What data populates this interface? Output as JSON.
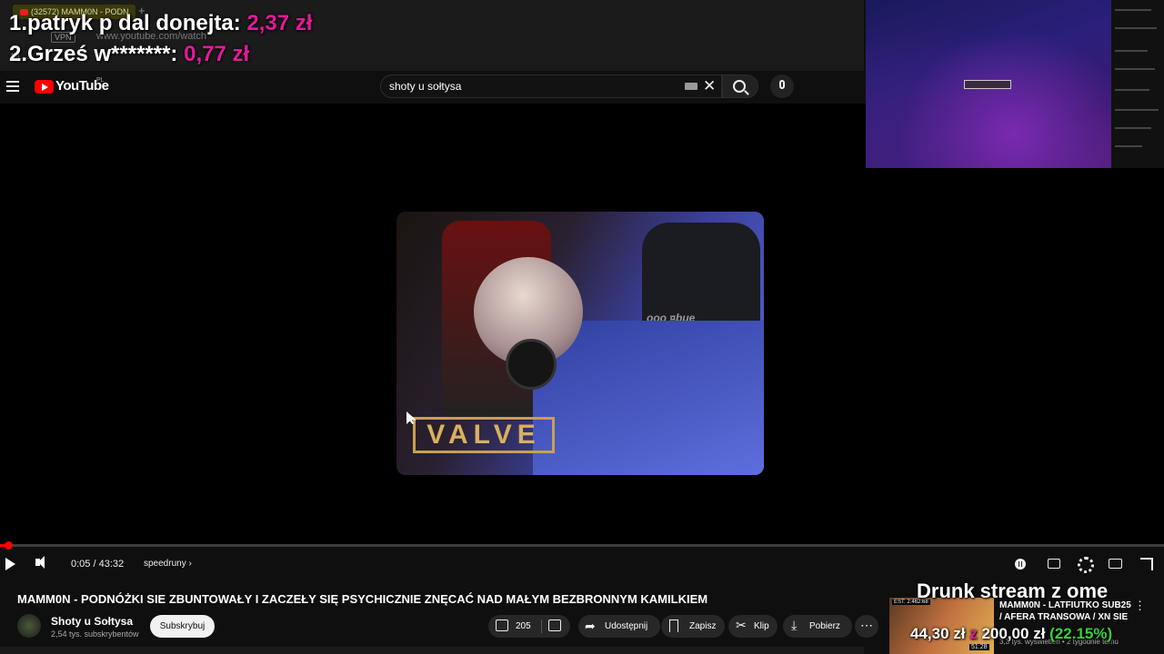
{
  "browser": {
    "tab_title": "(32572) MAMM0N - PODN",
    "new_tab": "+",
    "vpn_label": "VPN",
    "url": "www.youtube.com/watch",
    "bookmarks": "ML..."
  },
  "donations": [
    {
      "rank_name": "1.patryk p dal donejta:",
      "amount": "2,37 zł"
    },
    {
      "rank_name": "2.Grześ w*******:",
      "amount": "0,77 zł"
    }
  ],
  "header": {
    "logo_text": "YouTube",
    "logo_country": "PL",
    "search_value": "shoty u sołtysa"
  },
  "player": {
    "progress": 0.002,
    "time": "0:05 / 43:32",
    "chapter": "speedruny ›",
    "overlay_text": "VALVE",
    "chair_text": "ooo ¤bue"
  },
  "video": {
    "title": "MAMM0N - PODNÓŻKI SIE ZBUNTOWAŁY I ZACZEŁY SIĘ PSYCHICZNIE ZNĘCAĆ NAD MAŁYM BEZBRONNYM KAMILKIEM",
    "channel_name": "Shoty u Sołtysa",
    "channel_subs": "2,54 tys. subskrybentów",
    "subscribe_label": "Subskrybuj",
    "likes": "205",
    "share_label": "Udostępnij",
    "save_label": "Zapisz",
    "clip_label": "Klip",
    "download_label": "Pobierz",
    "more_label": "⋯"
  },
  "recommendation": {
    "est": "EST: 2:462:68",
    "duration": "51:28",
    "title": "MAMM0N - LATFIUTKO SUB25 / AFERA TRANSOWA / XN SIE ...",
    "meta": "3,3 tys. wyświetleń • 2 tygodnie temu",
    "more": "⋮"
  },
  "goal": {
    "title": "Drunk stream z ome",
    "current": "44,30 zł",
    "separator": "z",
    "target": "200,00 zł",
    "percent": "(22.15%)"
  },
  "colors": {
    "accent_pink": "#e6189d",
    "youtube_red": "#ff0000",
    "goal_green": "#35d23b"
  }
}
